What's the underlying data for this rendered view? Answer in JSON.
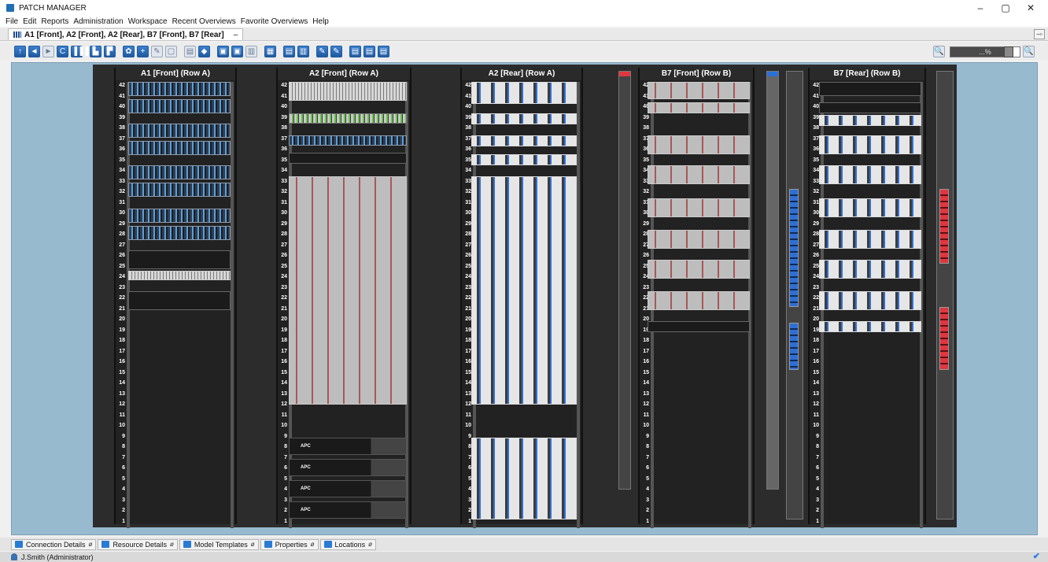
{
  "window": {
    "title": "PATCH MANAGER",
    "controls": [
      "–",
      "▢",
      "✕"
    ]
  },
  "menu": [
    "File",
    "Edit",
    "Reports",
    "Administration",
    "Workspace",
    "Recent Overviews",
    "Favorite Overviews",
    "Help"
  ],
  "document_tab": {
    "label": "A1 [Front], A2 [Front], A2 [Rear], B7 [Front], B7 [Rear]",
    "close": "–"
  },
  "panel_restore": "–▫",
  "toolbar": {
    "buttons": [
      "↑",
      "◄",
      "►",
      "C",
      "▐▐▐",
      "▙",
      "▛",
      "✿",
      "+",
      "✎",
      "▢",
      "▤",
      "◆",
      "▣",
      "▣",
      "▥",
      "▦",
      "▤",
      "▥",
      "✎",
      "✎",
      "▤",
      "▤",
      "▤"
    ],
    "zoom_out": "🔍",
    "zoom_in": "🔍",
    "zoom_value": "...%",
    "zoom_level": 0.84
  },
  "racks": [
    {
      "title": "A1 [Front] (Row A)"
    },
    {
      "title": "A2 [Front] (Row A)"
    },
    {
      "title": "A2 [Rear] (Row A)"
    },
    {
      "title": "B7 [Front] (Row B)"
    },
    {
      "title": "B7 [Rear] (Row B)"
    }
  ],
  "unit_numbers": [
    "42",
    "41",
    "40",
    "39",
    "38",
    "37",
    "36",
    "35",
    "34",
    "33",
    "32",
    "31",
    "30",
    "29",
    "28",
    "27",
    "26",
    "25",
    "24",
    "23",
    "22",
    "21",
    "20",
    "19",
    "18",
    "17",
    "16",
    "15",
    "14",
    "13",
    "12",
    "11",
    "10",
    "9",
    "8",
    "7",
    "6",
    "5",
    "4",
    "3",
    "2",
    "1"
  ],
  "device_labels": {
    "apc": "APC"
  },
  "bottom_tabs": [
    {
      "label": "Connection Details",
      "pin": "ø"
    },
    {
      "label": "Resource Details",
      "pin": "ø"
    },
    {
      "label": "Model Templates",
      "pin": "ø"
    },
    {
      "label": "Properties",
      "pin": "ø"
    },
    {
      "label": "Locations",
      "pin": "ø"
    }
  ],
  "status": {
    "user": "J.Smith (Administrator)",
    "check": "✔"
  },
  "colors": {
    "canvas": "#97bacf",
    "rack": "#222222",
    "accent": "#1f5aa0",
    "pdu_red": "#e0363f",
    "pdu_blue": "#2e6fd6"
  }
}
